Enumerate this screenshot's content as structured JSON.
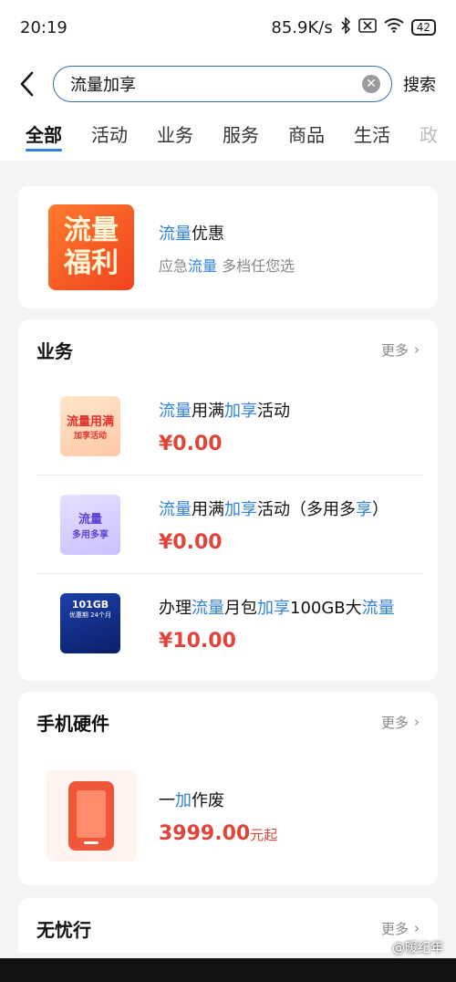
{
  "status": {
    "time": "20:19",
    "speed": "85.9K/s",
    "battery": "42"
  },
  "search": {
    "query": "流量加享",
    "button": "搜索"
  },
  "tabs": [
    "全部",
    "活动",
    "业务",
    "服务",
    "商品",
    "生活",
    "政"
  ],
  "promo": {
    "thumb_text_1": "流量",
    "thumb_text_2": "福利",
    "title_hl": "流量",
    "title_rest": "优惠",
    "sub_pre": "应急",
    "sub_hl": "流量",
    "sub_post": " 多档任您选"
  },
  "business": {
    "title": "业务",
    "more": "更多",
    "items": [
      {
        "t1": "流量",
        "t2": "用满",
        "t3": "加享",
        "t4": "活动",
        "t5": "",
        "t6": "",
        "price": "¥0.00",
        "thumb_1": "流量用满",
        "thumb_2": "加享活动"
      },
      {
        "t1": "流量",
        "t2": "用满",
        "t3": "加享",
        "t4": "活动（多用多",
        "t5": "享",
        "t6": "）",
        "price": "¥0.00",
        "thumb_1": "流量",
        "thumb_2": "多用多享"
      },
      {
        "t1": "办理",
        "t2": "流量",
        "t3": "月包",
        "t4": "加享",
        "t5": "100GB大",
        "t6": "流量",
        "price": "¥10.00",
        "thumb_1": "101GB",
        "thumb_2": "优惠期 24个月"
      }
    ]
  },
  "hardware": {
    "title": "手机硬件",
    "more": "更多",
    "item": {
      "t1": "一",
      "t2": "加",
      "t3": "作废",
      "price": "3999.00",
      "unit": "元起"
    }
  },
  "wuyouxing": {
    "title": "无忧行",
    "more": "更多"
  },
  "watermark": "@暖纪年",
  "colors": {
    "accent": "#2f82e0",
    "price": "#e0453a"
  }
}
